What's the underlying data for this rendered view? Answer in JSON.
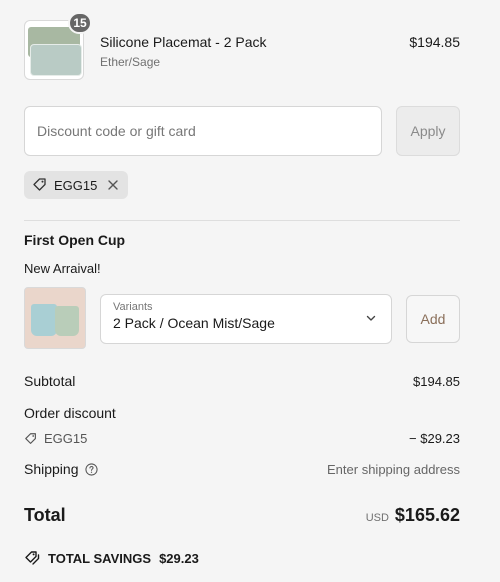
{
  "line_item": {
    "quantity": "15",
    "name": "Silicone Placemat - 2 Pack",
    "variant": "Ether/Sage",
    "price": "$194.85"
  },
  "discount": {
    "placeholder": "Discount code or gift card",
    "apply_label": "Apply",
    "applied_code": "EGG15"
  },
  "upsell": {
    "title": "First Open Cup",
    "subtitle": "New Arraival!",
    "select_label": "Variants",
    "select_value": "2 Pack / Ocean Mist/Sage",
    "add_label": "Add"
  },
  "summary": {
    "subtotal_label": "Subtotal",
    "subtotal_value": "$194.85",
    "order_discount_label": "Order discount",
    "discount_code": "EGG15",
    "discount_value": "− $29.23",
    "shipping_label": "Shipping",
    "shipping_value": "Enter shipping address",
    "total_label": "Total",
    "currency": "USD",
    "total_value": "$165.62",
    "savings_label": "TOTAL SAVINGS",
    "savings_value": "$29.23"
  }
}
